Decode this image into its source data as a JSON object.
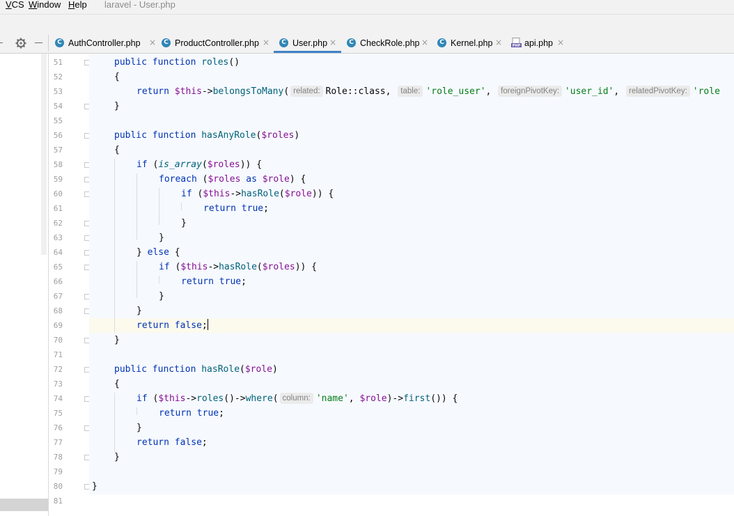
{
  "menu": {
    "vcs": "VCS",
    "window": "Window",
    "help": "Help",
    "title": "laravel - User.php"
  },
  "tabs": [
    {
      "label": "AuthController.php",
      "close": "×",
      "icon": "class-icon",
      "active": false
    },
    {
      "label": "ProductController.php",
      "close": "×",
      "icon": "class-icon",
      "active": false
    },
    {
      "label": "User.php",
      "close": "×",
      "icon": "class-icon",
      "active": true
    },
    {
      "label": "CheckRole.php",
      "close": "×",
      "icon": "class-icon",
      "active": false
    },
    {
      "label": "Kernel.php",
      "close": "×",
      "icon": "class-icon",
      "active": false
    },
    {
      "label": "api.php",
      "close": "×",
      "icon": "php-file-icon",
      "active": false
    }
  ],
  "icons": {
    "class_letter": "C",
    "php_badge": "PHP"
  },
  "line_numbers": [
    "51",
    "52",
    "53",
    "54",
    "55",
    "56",
    "57",
    "58",
    "59",
    "60",
    "61",
    "62",
    "63",
    "64",
    "65",
    "66",
    "67",
    "68",
    "69",
    "70",
    "71",
    "72",
    "73",
    "74",
    "75",
    "76",
    "77",
    "78",
    "79",
    "80",
    "81"
  ],
  "code": {
    "l51": {
      "kw": "public function ",
      "fn": "roles",
      "rest": "()"
    },
    "l52": {
      "t": "{"
    },
    "l53": {
      "kw": "return ",
      "v": "$this",
      "arrow": "->",
      "m": "belongsToMany",
      "open": "(",
      "h1": "related:",
      "t1": "Role::class, ",
      "h2": "table:",
      "s1": "'role_user'",
      "c1": ", ",
      "h3": "foreignPivotKey:",
      "s2": "'user_id'",
      "c2": ", ",
      "h4": "relatedPivotKey:",
      "s3": "'role"
    },
    "l54": {
      "t": "}"
    },
    "l56": {
      "kw": "public function ",
      "fn": "hasAnyRole",
      "p1": "(",
      "v": "$roles",
      "p2": ")"
    },
    "l57": {
      "t": "{"
    },
    "l58": {
      "kw": "if ",
      "p1": "(",
      "it": "is_array",
      "p2": "(",
      "v": "$roles",
      "p3": ")) {"
    },
    "l59": {
      "kw": "foreach ",
      "p1": "(",
      "v1": "$roles",
      "kw2": " as ",
      "v2": "$role",
      "p2": ") {"
    },
    "l60": {
      "kw": "if ",
      "p1": "(",
      "v1": "$this",
      "arrow": "->",
      "m": "hasRole",
      "p2": "(",
      "v2": "$role",
      "p3": ")) {"
    },
    "l61": {
      "kw": "return true",
      "t": ";"
    },
    "l62": {
      "t": "}"
    },
    "l63": {
      "t": "}"
    },
    "l64": {
      "t1": "} ",
      "kw": "else",
      "t2": " {"
    },
    "l65": {
      "kw": "if ",
      "p1": "(",
      "v1": "$this",
      "arrow": "->",
      "m": "hasRole",
      "p2": "(",
      "v2": "$roles",
      "p3": ")) {"
    },
    "l66": {
      "kw": "return true",
      "t": ";"
    },
    "l67": {
      "t": "}"
    },
    "l68": {
      "t": "}"
    },
    "l69": {
      "kw": "return false",
      "t": ";"
    },
    "l70": {
      "t": "}"
    },
    "l72": {
      "kw": "public function ",
      "fn": "hasRole",
      "p1": "(",
      "v": "$role",
      "p2": ")"
    },
    "l73": {
      "t": "{"
    },
    "l74": {
      "kw": "if ",
      "p1": "(",
      "v1": "$this",
      "a1": "->",
      "m1": "roles",
      "p2": "()->",
      "m2": "where",
      "p3": "(",
      "h": "column:",
      "s": "'name'",
      "c": ", ",
      "v2": "$role",
      "p4": ")->",
      "m3": "first",
      "p5": "()) {"
    },
    "l75": {
      "kw": "return true",
      "t": ";"
    },
    "l76": {
      "t": "}"
    },
    "l77": {
      "kw": "return false",
      "t": ";"
    },
    "l78": {
      "t": "}"
    },
    "l80": {
      "t": "}"
    }
  },
  "colors": {
    "keyword": "#0033b3",
    "function": "#00627a",
    "variable": "#871094",
    "string": "#067d17",
    "accent": "#4083c9"
  }
}
